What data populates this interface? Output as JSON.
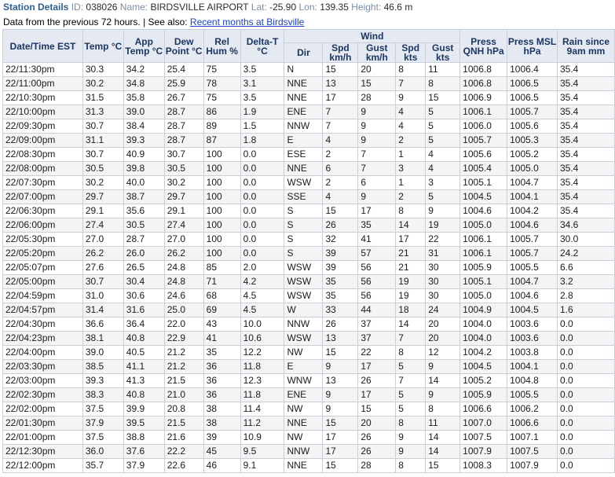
{
  "header": {
    "title": "Station Details",
    "id_label": "ID:",
    "id": "038026",
    "name_label": "Name:",
    "name": "BIRDSVILLE AIRPORT",
    "lat_label": "Lat:",
    "lat": "-25.90",
    "lon_label": "Lon:",
    "lon": "139.35",
    "height_label": "Height:",
    "height": "46.6 m"
  },
  "subtitle": {
    "text": "Data from the previous 72 hours. | See also:",
    "link": "Recent months at Birdsville"
  },
  "columns": {
    "datetime": "Date/Time EST",
    "temp": "Temp °C",
    "app_temp": "App Temp °C",
    "dew_point": "Dew Point °C",
    "rel_hum": "Rel Hum %",
    "delta_t": "Delta-T °C",
    "wind": "Wind",
    "dir": "Dir",
    "spd_kmh": "Spd km/h",
    "gust_kmh": "Gust km/h",
    "spd_kts": "Spd kts",
    "gust_kts": "Gust kts",
    "press_qnh": "Press QNH hPa",
    "press_msl": "Press MSL hPa",
    "rain": "Rain since 9am mm"
  },
  "rows": [
    [
      "22/11:30pm",
      "30.3",
      "34.2",
      "25.4",
      "75",
      "3.5",
      "N",
      "15",
      "20",
      "8",
      "11",
      "1006.8",
      "1006.4",
      "35.4"
    ],
    [
      "22/11:00pm",
      "30.2",
      "34.8",
      "25.9",
      "78",
      "3.1",
      "NNE",
      "13",
      "15",
      "7",
      "8",
      "1006.8",
      "1006.5",
      "35.4"
    ],
    [
      "22/10:30pm",
      "31.5",
      "35.8",
      "26.7",
      "75",
      "3.5",
      "NNE",
      "17",
      "28",
      "9",
      "15",
      "1006.9",
      "1006.5",
      "35.4"
    ],
    [
      "22/10:00pm",
      "31.3",
      "39.0",
      "28.7",
      "86",
      "1.9",
      "ENE",
      "7",
      "9",
      "4",
      "5",
      "1006.1",
      "1005.7",
      "35.4"
    ],
    [
      "22/09:30pm",
      "30.7",
      "38.4",
      "28.7",
      "89",
      "1.5",
      "NNW",
      "7",
      "9",
      "4",
      "5",
      "1006.0",
      "1005.6",
      "35.4"
    ],
    [
      "22/09:00pm",
      "31.1",
      "39.3",
      "28.7",
      "87",
      "1.8",
      "E",
      "4",
      "9",
      "2",
      "5",
      "1005.7",
      "1005.3",
      "35.4"
    ],
    [
      "22/08:30pm",
      "30.7",
      "40.9",
      "30.7",
      "100",
      "0.0",
      "ESE",
      "2",
      "7",
      "1",
      "4",
      "1005.6",
      "1005.2",
      "35.4"
    ],
    [
      "22/08:00pm",
      "30.5",
      "39.8",
      "30.5",
      "100",
      "0.0",
      "NNE",
      "6",
      "7",
      "3",
      "4",
      "1005.4",
      "1005.0",
      "35.4"
    ],
    [
      "22/07:30pm",
      "30.2",
      "40.0",
      "30.2",
      "100",
      "0.0",
      "WSW",
      "2",
      "6",
      "1",
      "3",
      "1005.1",
      "1004.7",
      "35.4"
    ],
    [
      "22/07:00pm",
      "29.7",
      "38.7",
      "29.7",
      "100",
      "0.0",
      "SSE",
      "4",
      "9",
      "2",
      "5",
      "1004.5",
      "1004.1",
      "35.4"
    ],
    [
      "22/06:30pm",
      "29.1",
      "35.6",
      "29.1",
      "100",
      "0.0",
      "S",
      "15",
      "17",
      "8",
      "9",
      "1004.6",
      "1004.2",
      "35.4"
    ],
    [
      "22/06:00pm",
      "27.4",
      "30.5",
      "27.4",
      "100",
      "0.0",
      "S",
      "26",
      "35",
      "14",
      "19",
      "1005.0",
      "1004.6",
      "34.6"
    ],
    [
      "22/05:30pm",
      "27.0",
      "28.7",
      "27.0",
      "100",
      "0.0",
      "S",
      "32",
      "41",
      "17",
      "22",
      "1006.1",
      "1005.7",
      "30.0"
    ],
    [
      "22/05:20pm",
      "26.2",
      "26.0",
      "26.2",
      "100",
      "0.0",
      "S",
      "39",
      "57",
      "21",
      "31",
      "1006.1",
      "1005.7",
      "24.2"
    ],
    [
      "22/05:07pm",
      "27.6",
      "26.5",
      "24.8",
      "85",
      "2.0",
      "WSW",
      "39",
      "56",
      "21",
      "30",
      "1005.9",
      "1005.5",
      "6.6"
    ],
    [
      "22/05:00pm",
      "30.7",
      "30.4",
      "24.8",
      "71",
      "4.2",
      "WSW",
      "35",
      "56",
      "19",
      "30",
      "1005.1",
      "1004.7",
      "3.2"
    ],
    [
      "22/04:59pm",
      "31.0",
      "30.6",
      "24.6",
      "68",
      "4.5",
      "WSW",
      "35",
      "56",
      "19",
      "30",
      "1005.0",
      "1004.6",
      "2.8"
    ],
    [
      "22/04:57pm",
      "31.4",
      "31.6",
      "25.0",
      "69",
      "4.5",
      "W",
      "33",
      "44",
      "18",
      "24",
      "1004.9",
      "1004.5",
      "1.6"
    ],
    [
      "22/04:30pm",
      "36.6",
      "36.4",
      "22.0",
      "43",
      "10.0",
      "NNW",
      "26",
      "37",
      "14",
      "20",
      "1004.0",
      "1003.6",
      "0.0"
    ],
    [
      "22/04:23pm",
      "38.1",
      "40.8",
      "22.9",
      "41",
      "10.6",
      "WSW",
      "13",
      "37",
      "7",
      "20",
      "1004.0",
      "1003.6",
      "0.0"
    ],
    [
      "22/04:00pm",
      "39.0",
      "40.5",
      "21.2",
      "35",
      "12.2",
      "NW",
      "15",
      "22",
      "8",
      "12",
      "1004.2",
      "1003.8",
      "0.0"
    ],
    [
      "22/03:30pm",
      "38.5",
      "41.1",
      "21.2",
      "36",
      "11.8",
      "E",
      "9",
      "17",
      "5",
      "9",
      "1004.5",
      "1004.1",
      "0.0"
    ],
    [
      "22/03:00pm",
      "39.3",
      "41.3",
      "21.5",
      "36",
      "12.3",
      "WNW",
      "13",
      "26",
      "7",
      "14",
      "1005.2",
      "1004.8",
      "0.0"
    ],
    [
      "22/02:30pm",
      "38.3",
      "40.8",
      "21.0",
      "36",
      "11.8",
      "ENE",
      "9",
      "17",
      "5",
      "9",
      "1005.9",
      "1005.5",
      "0.0"
    ],
    [
      "22/02:00pm",
      "37.5",
      "39.9",
      "20.8",
      "38",
      "11.4",
      "NW",
      "9",
      "15",
      "5",
      "8",
      "1006.6",
      "1006.2",
      "0.0"
    ],
    [
      "22/01:30pm",
      "37.9",
      "39.5",
      "21.5",
      "38",
      "11.2",
      "NNE",
      "15",
      "20",
      "8",
      "11",
      "1007.0",
      "1006.6",
      "0.0"
    ],
    [
      "22/01:00pm",
      "37.5",
      "38.8",
      "21.6",
      "39",
      "10.9",
      "NW",
      "17",
      "26",
      "9",
      "14",
      "1007.5",
      "1007.1",
      "0.0"
    ],
    [
      "22/12:30pm",
      "36.0",
      "37.6",
      "22.2",
      "45",
      "9.5",
      "NNW",
      "17",
      "26",
      "9",
      "14",
      "1007.9",
      "1007.5",
      "0.0"
    ],
    [
      "22/12:00pm",
      "35.7",
      "37.9",
      "22.6",
      "46",
      "9.1",
      "NNE",
      "15",
      "28",
      "8",
      "15",
      "1008.3",
      "1007.9",
      "0.0"
    ]
  ]
}
